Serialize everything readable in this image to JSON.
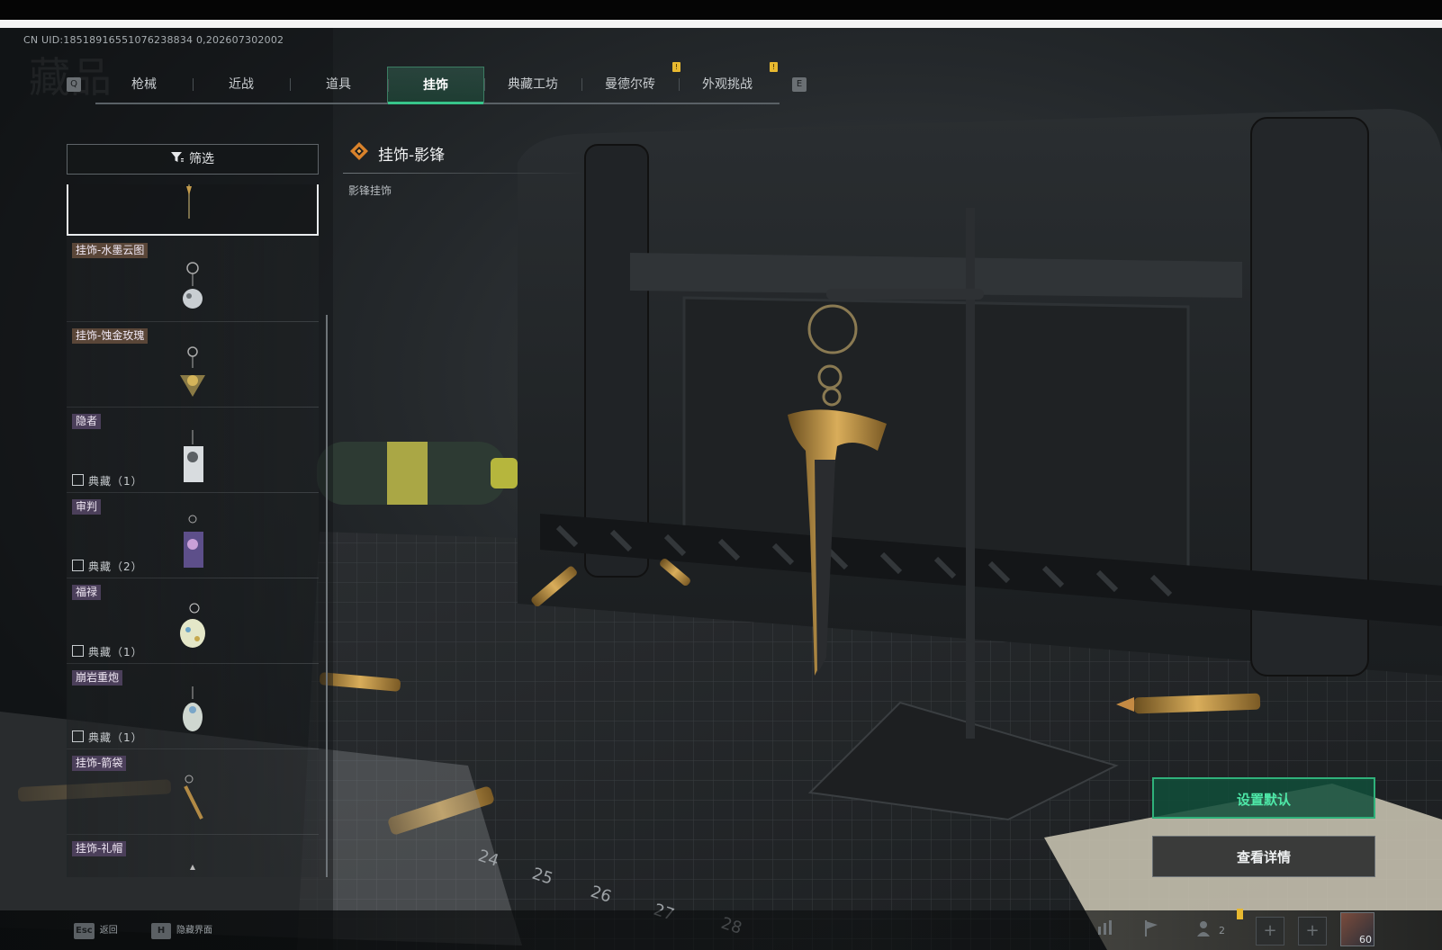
{
  "header_bar": {
    "uid_text": "CN UID:18518916551076238834 0,202607302002",
    "ghost_title": "藏品"
  },
  "tabs": {
    "left_key": "Q",
    "right_key": "E",
    "items": [
      {
        "label": "枪械",
        "badge": false
      },
      {
        "label": "近战",
        "badge": false
      },
      {
        "label": "道具",
        "badge": false
      },
      {
        "label": "挂饰",
        "badge": false,
        "active": true
      },
      {
        "label": "典藏工坊",
        "badge": false
      },
      {
        "label": "曼德尔砖",
        "badge": true
      },
      {
        "label": "外观挑战",
        "badge": true
      }
    ]
  },
  "filter": {
    "label": "筛选"
  },
  "list": {
    "items": [
      {
        "tag": "挂饰-水墨云图",
        "collect": ""
      },
      {
        "tag": "挂饰-蚀金玫瑰",
        "collect": ""
      },
      {
        "tag": "隐者",
        "collect": "典藏（1）"
      },
      {
        "tag": "审判",
        "collect": "典藏（2）"
      },
      {
        "tag": "福禄",
        "collect": "典藏（1）"
      },
      {
        "tag": "崩岩重炮",
        "collect": "典藏（1）"
      },
      {
        "tag": "挂饰-箭袋",
        "collect": ""
      },
      {
        "tag": "挂饰-礼帽",
        "collect": ""
      }
    ]
  },
  "detail": {
    "title": "挂饰-影锋",
    "subtitle": "影锋挂饰"
  },
  "actions": {
    "set_default": "设置默认",
    "view_detail": "查看详情"
  },
  "bottom": {
    "back_key": "Esc",
    "back_label": "返回",
    "hide_key": "H",
    "hide_label": "隐藏界面",
    "friend_count": "2",
    "avatar_level": "60"
  },
  "icons": [
    "filter-icon",
    "diamond-icon",
    "stats-icon",
    "flag-icon",
    "friends-icon",
    "plus-icon",
    "image-icon"
  ],
  "colors": {
    "accent_green": "#37c58a",
    "badge_yellow": "#e8b930",
    "tag_purple": "#4b3f5a"
  }
}
